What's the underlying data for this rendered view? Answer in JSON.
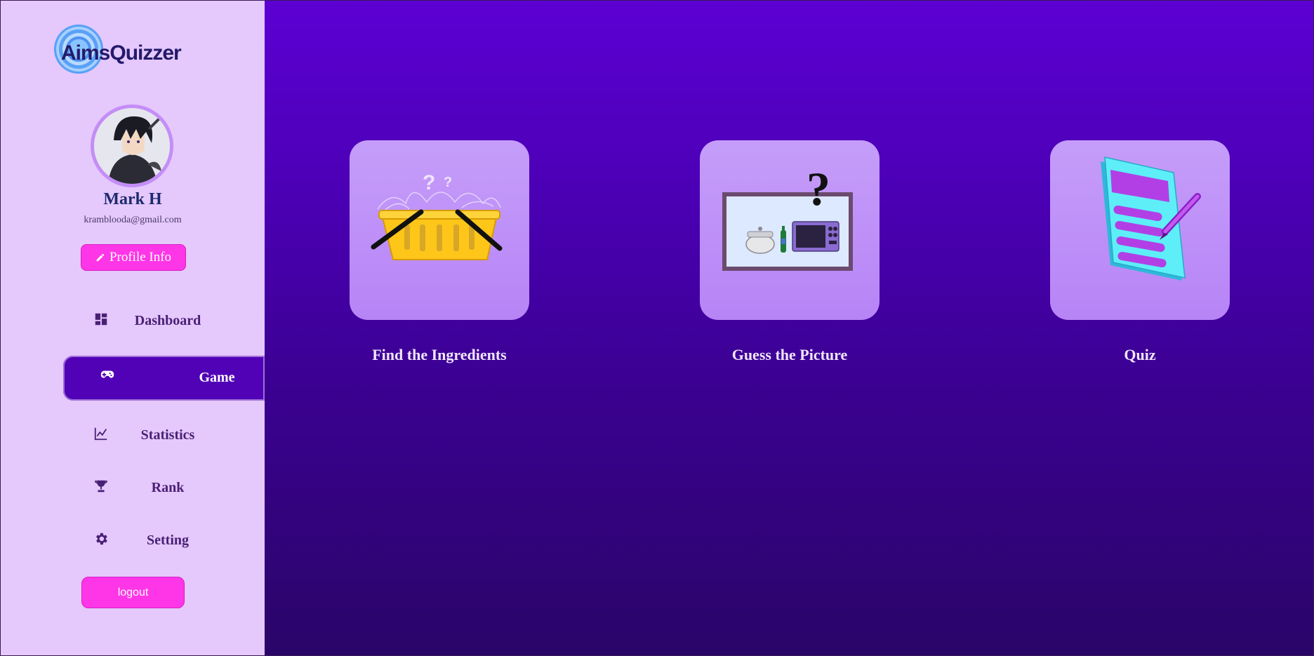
{
  "app": {
    "logo_text": "AimsQuizzer"
  },
  "user": {
    "name": "Mark H",
    "email": "kramblooda@gmail.com"
  },
  "sidebar": {
    "profile_button": "Profile Info",
    "items": [
      {
        "label": "Dashboard",
        "icon": "dashboard-icon"
      },
      {
        "label": "Game",
        "icon": "gamepad-icon",
        "active": true
      },
      {
        "label": "Statistics",
        "icon": "chart-line-icon"
      },
      {
        "label": "Rank",
        "icon": "trophy-icon"
      },
      {
        "label": "Setting",
        "icon": "gear-icon"
      }
    ],
    "logout_button": "logout"
  },
  "games": [
    {
      "title": "Find the Ingredients",
      "icon": "basket-icon"
    },
    {
      "title": "Guess the Picture",
      "icon": "picture-question-icon"
    },
    {
      "title": "Quiz",
      "icon": "quiz-paper-icon"
    }
  ],
  "colors": {
    "sidebar_bg": "#e5c8fc",
    "accent_pink": "#ff35e8",
    "active_nav": "#5102b6",
    "main_gradient_top": "#5c00d3",
    "main_gradient_bottom": "#2a0568",
    "card_bg": "#c59df9"
  }
}
